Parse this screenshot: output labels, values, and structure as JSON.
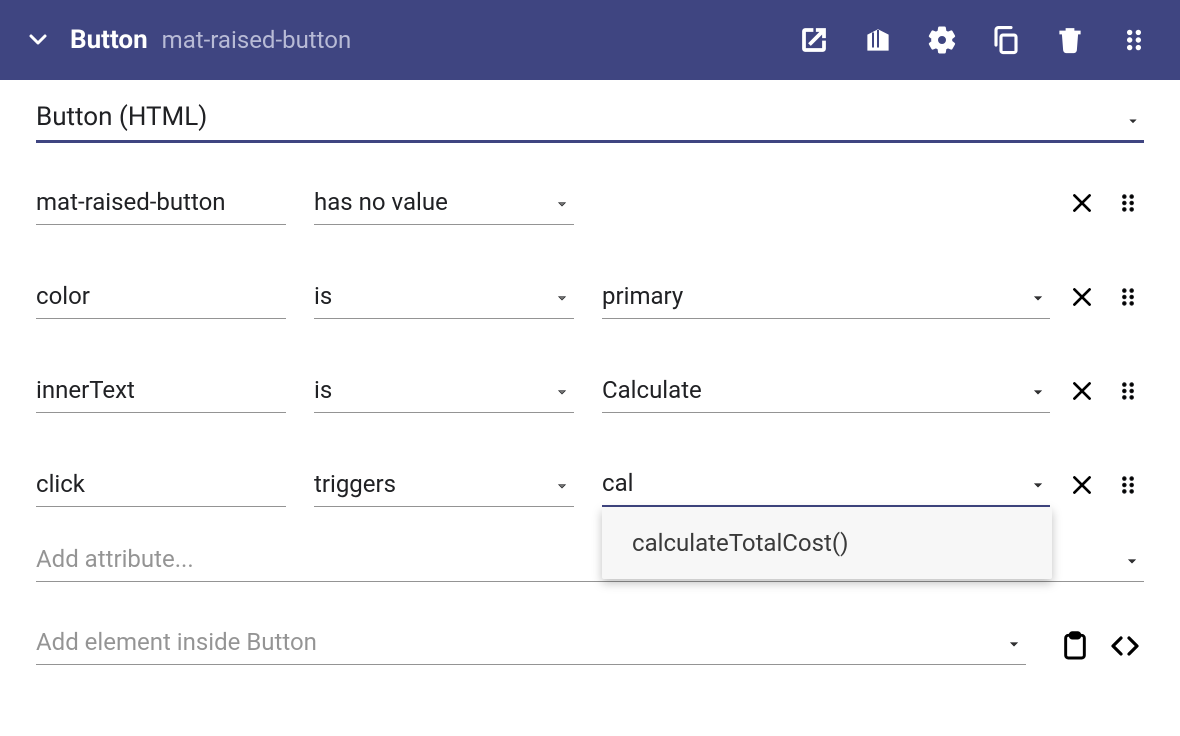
{
  "header": {
    "title": "Button",
    "subtitle": "mat-raised-button"
  },
  "element_type": "Button (HTML)",
  "attributes": [
    {
      "name": "mat-raised-button",
      "op": "has no value",
      "value": null
    },
    {
      "name": "color",
      "op": "is",
      "value": "primary"
    },
    {
      "name": "innerText",
      "op": "is",
      "value": "Calculate"
    },
    {
      "name": "click",
      "op": "triggers",
      "value": "cal",
      "active": true
    }
  ],
  "add_attribute_placeholder": "Add attribute...",
  "add_element_placeholder": "Add element inside Button",
  "autocomplete": {
    "visible_for_row": 3,
    "options": [
      "calculateTotalCost()"
    ]
  }
}
